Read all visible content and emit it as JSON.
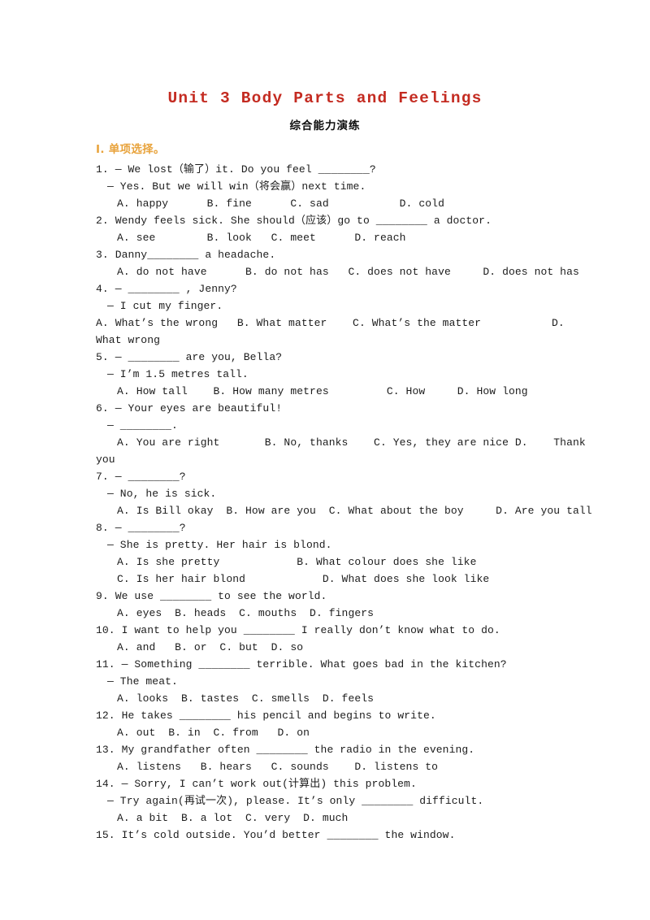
{
  "document": {
    "title": "Unit 3 Body Parts and Feelings",
    "subtitle": "综合能力演练",
    "section_heading": "I. 单项选择。",
    "colors": {
      "title": "#c42b21",
      "subtitle": "#0d0d0d",
      "section_heading": "#e8a33c",
      "body_text": "#1c1c1c",
      "page_background": "#ffffff"
    }
  },
  "lines": [
    {
      "level": 0,
      "text": "1. — We lost（输了）it. Do you feel ________?"
    },
    {
      "level": 1,
      "text": "— Yes. But we will win（将会赢）next time."
    },
    {
      "level": 2,
      "text": "A. happy      B. fine      C. sad           D. cold"
    },
    {
      "level": 0,
      "text": "2. Wendy feels sick. She should（应该）go to ________ a doctor."
    },
    {
      "level": 2,
      "text": "A. see        B. look   C. meet      D. reach"
    },
    {
      "level": 0,
      "text": "3. Danny________ a headache."
    },
    {
      "level": 2,
      "text": "A. do not have      B. do not has   C. does not have     D. does not has"
    },
    {
      "level": 0,
      "text": "4. — ________ , Jenny?"
    },
    {
      "level": 1,
      "text": "— I cut my finger."
    },
    {
      "level": 0,
      "text": "A. What’s the wrong   B. What matter    C. What’s the matter           D."
    },
    {
      "level": 0,
      "text": "What wrong"
    },
    {
      "level": 0,
      "text": "5. — ________ are you, Bella?"
    },
    {
      "level": 1,
      "text": "— I’m 1.5 metres tall."
    },
    {
      "level": 2,
      "text": "A. How tall    B. How many metres         C. How     D. How long"
    },
    {
      "level": 0,
      "text": "6. — Your eyes are beautiful!"
    },
    {
      "level": 1,
      "text": "— ________."
    },
    {
      "level": 2,
      "text": "A. You are right       B. No, thanks    C. Yes, they are nice D.    Thank"
    },
    {
      "level": 0,
      "text": "you"
    },
    {
      "level": 0,
      "text": "7. — ________?"
    },
    {
      "level": 1,
      "text": "— No, he is sick."
    },
    {
      "level": 2,
      "text": "A. Is Bill okay  B. How are you  C. What about the boy     D. Are you tall"
    },
    {
      "level": 0,
      "text": "8. — ________?"
    },
    {
      "level": 1,
      "text": "— She is pretty. Her hair is blond."
    },
    {
      "level": 2,
      "text": "A. Is she pretty            B. What colour does she like"
    },
    {
      "level": 2,
      "text": "C. Is her hair blond            D. What does she look like"
    },
    {
      "level": 0,
      "text": "9. We use ________ to see the world."
    },
    {
      "level": 2,
      "text": "A. eyes  B. heads  C. mouths  D. fingers"
    },
    {
      "level": 0,
      "text": "10. I want to help you ________ I really don’t know what to do."
    },
    {
      "level": 2,
      "text": "A. and   B. or  C. but  D. so"
    },
    {
      "level": 0,
      "text": "11. — Something ________ terrible. What goes bad in the kitchen?"
    },
    {
      "level": 1,
      "text": "— The meat."
    },
    {
      "level": 2,
      "text": "A. looks  B. tastes  C. smells  D. feels"
    },
    {
      "level": 0,
      "text": "12. He takes ________ his pencil and begins to write."
    },
    {
      "level": 2,
      "text": "A. out  B. in  C. from   D. on"
    },
    {
      "level": 0,
      "text": "13. My grandfather often ________ the radio in the evening."
    },
    {
      "level": 2,
      "text": "A. listens   B. hears   C. sounds    D. listens to"
    },
    {
      "level": 0,
      "text": "14. — Sorry, I can’t work out(计算出) this problem."
    },
    {
      "level": 1,
      "text": "— Try again(再试一次), please. It’s only ________ difficult."
    },
    {
      "level": 2,
      "text": "A. a bit  B. a lot  C. very  D. much"
    },
    {
      "level": 0,
      "text": "15. It’s cold outside. You’d better ________ the window."
    }
  ],
  "questions": [
    {
      "number": "1",
      "stem": "— We lost（输了）it. Do you feel ________?",
      "reply": "— Yes. But we will win（将会赢）next time.",
      "options": [
        "A. happy",
        "B. fine",
        "C. sad",
        "D. cold"
      ]
    },
    {
      "number": "2",
      "stem": "Wendy feels sick. She should（应该）go to ________ a doctor.",
      "options": [
        "A. see",
        "B. look",
        "C. meet",
        "D. reach"
      ]
    },
    {
      "number": "3",
      "stem": "Danny________ a headache.",
      "options": [
        "A. do not have",
        "B. do not has",
        "C. does not have",
        "D. does not has"
      ]
    },
    {
      "number": "4",
      "stem": "— ________ , Jenny?",
      "reply": "— I cut my finger.",
      "options": [
        "A. What’s the wrong",
        "B. What matter",
        "C. What’s the matter",
        "D. What wrong"
      ]
    },
    {
      "number": "5",
      "stem": "— ________ are you, Bella?",
      "reply": "— I’m 1.5 metres tall.",
      "options": [
        "A. How tall",
        "B. How many metres",
        "C. How",
        "D. How long"
      ]
    },
    {
      "number": "6",
      "stem": "— Your eyes are beautiful!",
      "reply": "— ________.",
      "options": [
        "A. You are right",
        "B. No, thanks",
        "C. Yes, they are nice",
        "D. Thank you"
      ]
    },
    {
      "number": "7",
      "stem": "— ________?",
      "reply": "— No, he is sick.",
      "options": [
        "A. Is Bill okay",
        "B. How are you",
        "C. What about the boy",
        "D. Are you tall"
      ]
    },
    {
      "number": "8",
      "stem": "— ________?",
      "reply": "— She is pretty. Her hair is blond.",
      "options": [
        "A. Is she pretty",
        "B. What colour does she like",
        "C. Is her hair blond",
        "D. What does she look like"
      ]
    },
    {
      "number": "9",
      "stem": "We use ________ to see the world.",
      "options": [
        "A. eyes",
        "B. heads",
        "C. mouths",
        "D. fingers"
      ]
    },
    {
      "number": "10",
      "stem": "I want to help you ________ I really don’t know what to do.",
      "options": [
        "A. and",
        "B. or",
        "C. but",
        "D. so"
      ]
    },
    {
      "number": "11",
      "stem": "— Something ________ terrible. What goes bad in the kitchen?",
      "reply": "— The meat.",
      "options": [
        "A. looks",
        "B. tastes",
        "C. smells",
        "D. feels"
      ]
    },
    {
      "number": "12",
      "stem": "He takes ________ his pencil and begins to write.",
      "options": [
        "A. out",
        "B. in",
        "C. from",
        "D. on"
      ]
    },
    {
      "number": "13",
      "stem": "My grandfather often ________ the radio in the evening.",
      "options": [
        "A. listens",
        "B. hears",
        "C. sounds",
        "D. listens to"
      ]
    },
    {
      "number": "14",
      "stem": "— Sorry, I can’t work out(计算出) this problem.",
      "reply": "— Try again(再试一次), please. It’s only ________ difficult.",
      "options": [
        "A. a bit",
        "B. a lot",
        "C. very",
        "D. much"
      ]
    },
    {
      "number": "15",
      "stem": "It’s cold outside. You’d better ________ the window.",
      "options": []
    }
  ]
}
